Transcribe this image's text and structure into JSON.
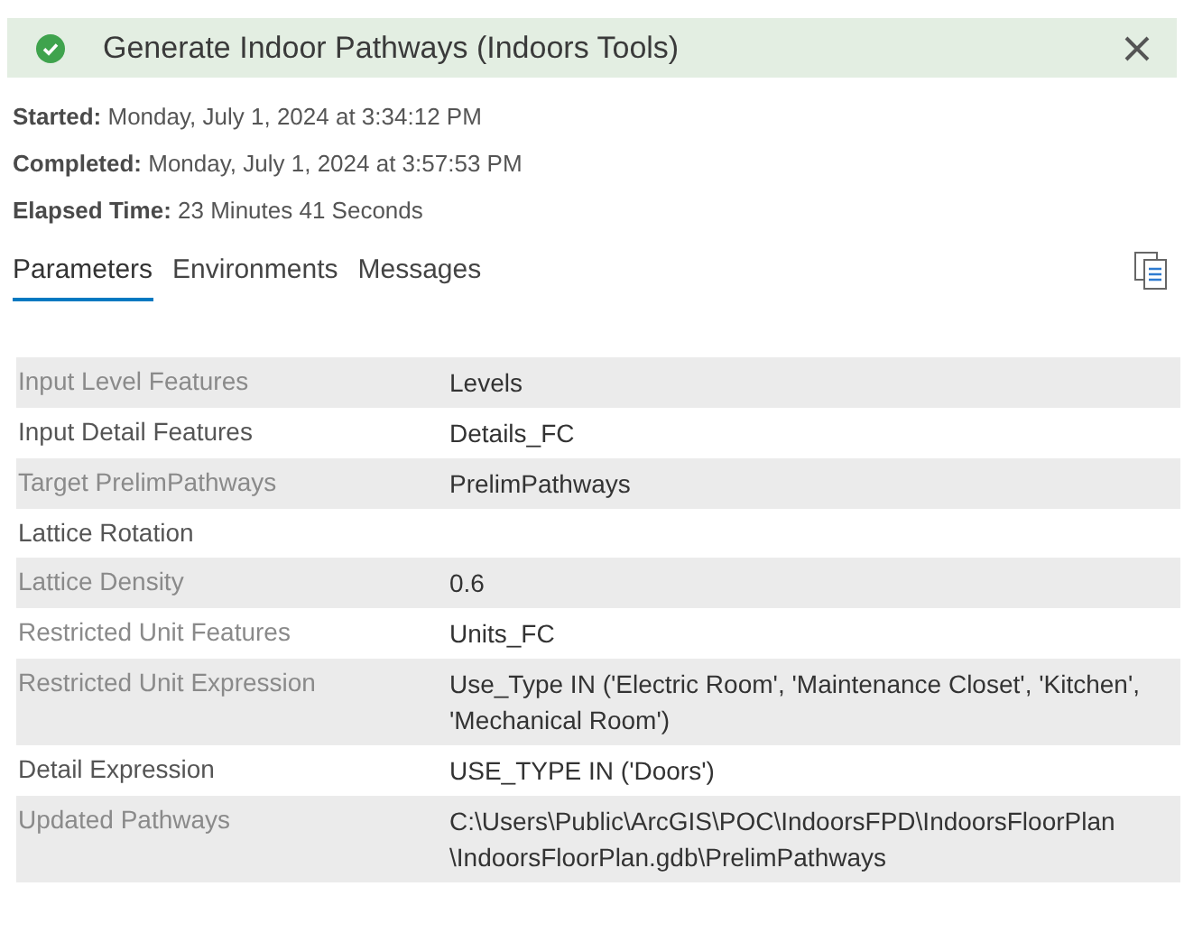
{
  "header": {
    "succeeded": true,
    "title": "Generate Indoor Pathways (Indoors Tools)"
  },
  "info": [
    {
      "label": "Started:",
      "value": "Monday, July 1, 2024 at 3:34:12 PM"
    },
    {
      "label": "Completed:",
      "value": "Monday, July 1, 2024 at 3:57:53 PM"
    },
    {
      "label": "Elapsed Time:",
      "value": "23 Minutes 41 Seconds"
    }
  ],
  "tabs": [
    {
      "label": "Parameters",
      "selected": true
    },
    {
      "label": "Environments",
      "selected": false
    },
    {
      "label": "Messages",
      "selected": false
    }
  ],
  "parameters": [
    {
      "name": "Input Level Features",
      "dimmed": true,
      "lines": [
        "Levels"
      ]
    },
    {
      "name": "Input Detail Features",
      "dimmed": false,
      "lines": [
        "Details_FC"
      ]
    },
    {
      "name": "Target PrelimPathways",
      "dimmed": true,
      "lines": [
        "PrelimPathways"
      ]
    },
    {
      "name": "Lattice Rotation",
      "dimmed": false
    },
    {
      "name": "Lattice Density",
      "dimmed": true,
      "lines": [
        "0.6"
      ]
    },
    {
      "name": "Restricted Unit Features",
      "dimmed": true,
      "lines": [
        "Units_FC"
      ]
    },
    {
      "name": "Restricted Unit Expression",
      "dimmed": true,
      "lines": [
        "Use_Type IN ('Electric Room', 'Maintenance Closet', 'Kitchen',",
        "'Mechanical Room')"
      ]
    },
    {
      "name": "Detail Expression",
      "dimmed": false,
      "lines": [
        "USE_TYPE IN ('Doors')"
      ]
    },
    {
      "name": "Updated Pathways",
      "dimmed": true,
      "lines": [
        "C:\\Users\\Public\\ArcGIS\\POC\\IndoorsFPD\\IndoorsFloorPlan",
        "\\IndoorsFloorPlan.gdb\\PrelimPathways"
      ]
    }
  ]
}
